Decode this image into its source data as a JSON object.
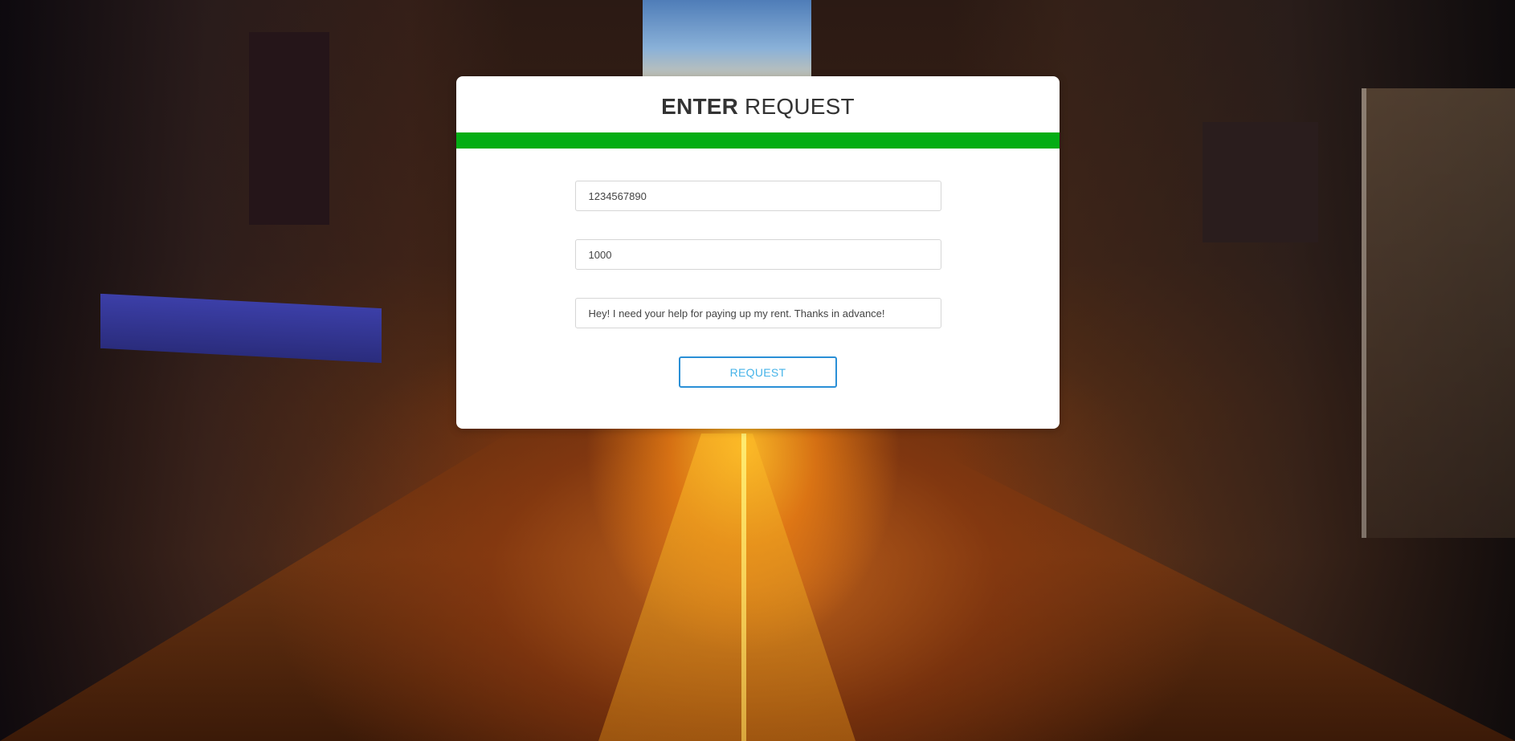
{
  "form": {
    "title_bold": "ENTER",
    "title_rest": " REQUEST",
    "fields": [
      {
        "value": "1234567890"
      },
      {
        "value": "1000"
      },
      {
        "value": "Hey! I need your help for paying up my rent. Thanks in advance!"
      }
    ],
    "submit_label": "REQUEST"
  },
  "colors": {
    "accent_bar": "#04ad14",
    "button_border": "#2a8fd6",
    "button_text": "#45b3e8"
  }
}
